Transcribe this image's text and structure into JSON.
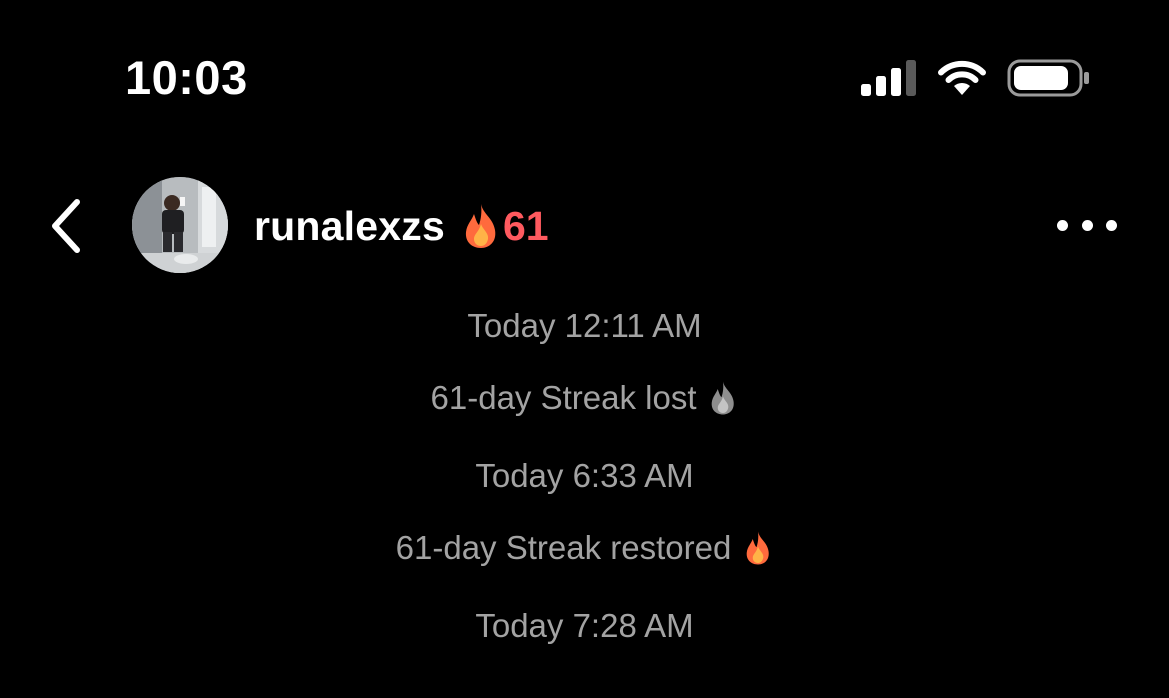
{
  "status_bar": {
    "time": "10:03",
    "icons": [
      "cellular-signal-icon",
      "wifi-icon",
      "battery-icon"
    ]
  },
  "header": {
    "back_icon": "chevron-left-icon",
    "avatar_icon": "profile-photo",
    "username": "runalexzs",
    "streak_icon": "fire-icon",
    "streak_count": "61",
    "more_icon": "more-horizontal-icon"
  },
  "conversation": {
    "items": [
      {
        "type": "timestamp",
        "text": "Today 12:11 AM"
      },
      {
        "type": "event",
        "text": "61-day Streak lost",
        "icon": "fire-gray-icon"
      },
      {
        "type": "timestamp",
        "text": "Today 6:33 AM"
      },
      {
        "type": "event",
        "text": "61-day Streak restored",
        "icon": "fire-icon"
      },
      {
        "type": "timestamp",
        "text": "Today 7:28 AM"
      }
    ]
  },
  "colors": {
    "background": "#000000",
    "text_primary": "#ffffff",
    "text_secondary": "#a3a3a3",
    "streak_accent": "#ff5a5f",
    "fire_outer": "#ff6a3d",
    "fire_inner": "#ffb347",
    "fire_lost": "#8e8e8e"
  }
}
